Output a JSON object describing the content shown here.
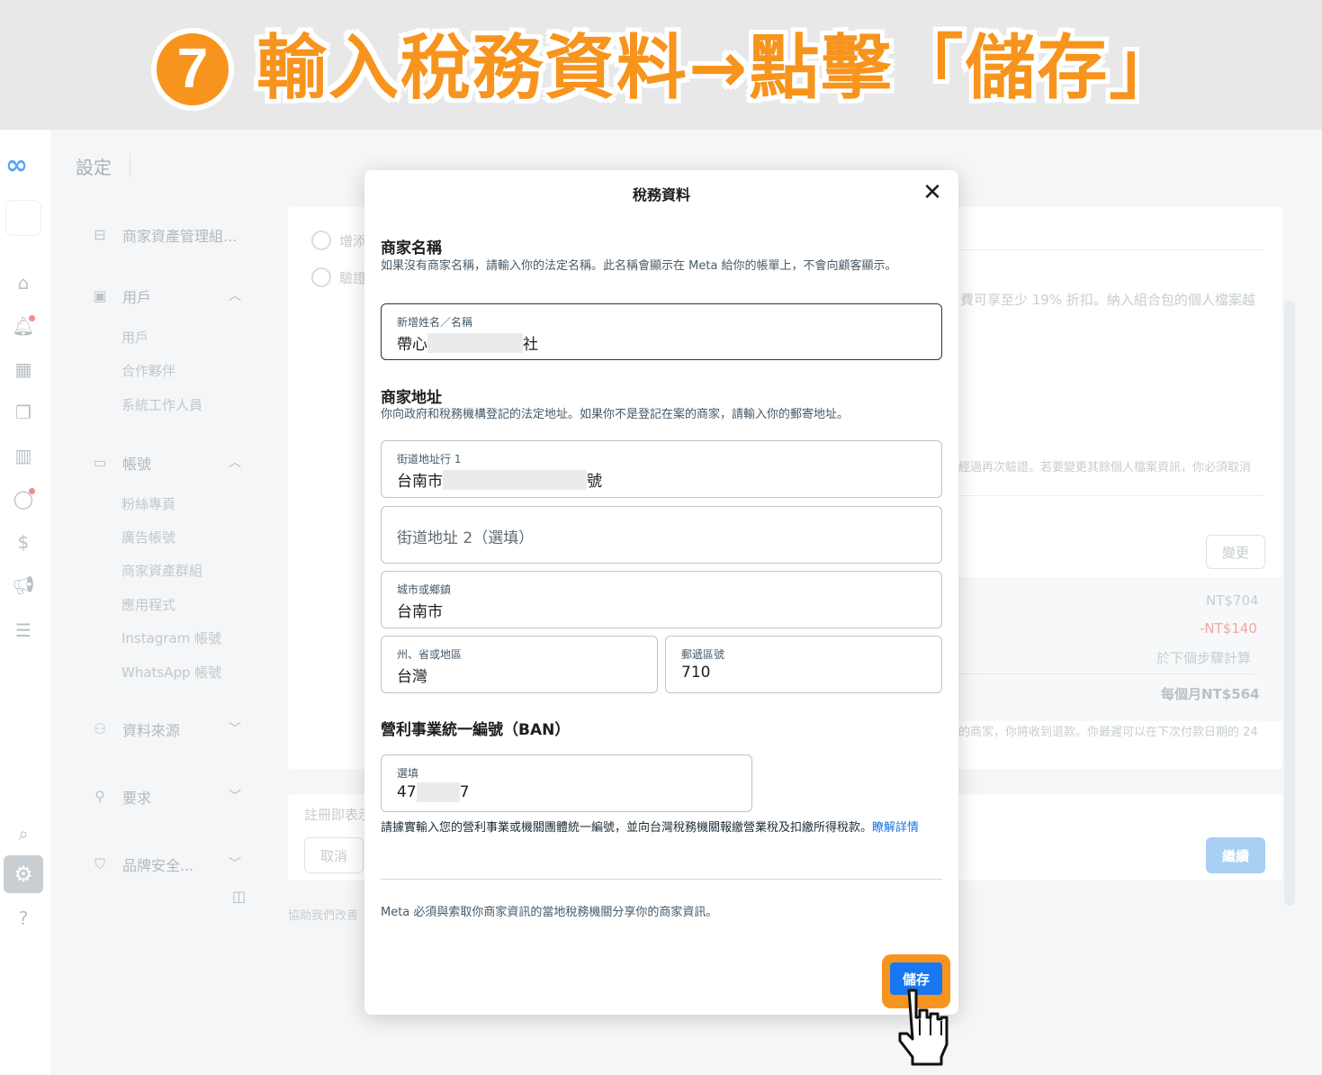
{
  "banner": {
    "step_number": "7",
    "title": "輸入稅務資料→點擊「儲存」"
  },
  "sidebar": {
    "title": "設定",
    "sections": [
      {
        "label": "商家資產管理組...",
        "icon": "briefcase-icon"
      },
      {
        "label": "用戶",
        "icon": "person-card-icon",
        "items": [
          "用戶",
          "合作夥伴",
          "系統工作人員"
        ]
      },
      {
        "label": "帳號",
        "icon": "folder-icon",
        "items": [
          "粉絲專頁",
          "廣告帳號",
          "商家資產群組",
          "應用程式",
          "Instagram 帳號",
          "WhatsApp 帳號"
        ]
      },
      {
        "label": "資料來源",
        "icon": "people-icon"
      },
      {
        "label": "要求",
        "icon": "person-add-icon"
      },
      {
        "label": "品牌安全...",
        "icon": "shield-icon"
      }
    ]
  },
  "background": {
    "steps": [
      "增添",
      "驗證"
    ],
    "discount_text": "費可享至少 19% 折扣。納入組合包的個人檔案越",
    "verify_text": "經過再次驗證。若要變更其餘個人檔案資訊，你必須取消",
    "change_button": "變更",
    "price_1": "NT$704",
    "price_2": "-NT$140",
    "price_note": "於下個步驟計算",
    "monthly": "每個月NT$564",
    "refund_text": "的商家，你將收到退款。你最遲可以在下次付款日期的 24",
    "register_text": "註冊即表示",
    "cancel_button": "取消",
    "continue_button": "繼續",
    "help_text": "協助我們改善"
  },
  "modal": {
    "title": "稅務資料",
    "business_name": {
      "heading": "商家名稱",
      "description": "如果沒有商家名稱，請輸入你的法定名稱。此名稱會顯示在 Meta 給你的帳單上，不會向顧客顯示。",
      "field_label": "新增姓名／名稱",
      "value_prefix": "帶心",
      "value_suffix": "社"
    },
    "address": {
      "heading": "商家地址",
      "description": "你向政府和稅務機構登記的法定地址。如果你不是登記在案的商家，請輸入你的郵寄地址。",
      "street1_label": "街道地址行 1",
      "street1_prefix": "台南市",
      "street1_suffix": "號",
      "street2_placeholder": "街道地址 2（選填）",
      "city_label": "城市或鄉鎮",
      "city_value": "台南市",
      "state_label": "州、省或地區",
      "state_value": "台灣",
      "zip_label": "郵遞區號",
      "zip_value": "710"
    },
    "ban": {
      "heading": "營利事業統一編號（BAN）",
      "field_label": "選填",
      "value_prefix": "47",
      "value_suffix": "7",
      "note": "請據實輸入您的營利事業或機關團體統一編號，並向台灣稅務機關報繳營業稅及扣繳所得稅款。",
      "link": "瞭解詳情"
    },
    "footer_note": "Meta 必須與索取你商家資訊的當地稅務機關分享你的商家資訊。",
    "save_button": "儲存"
  },
  "colors": {
    "accent_orange": "#f7941d",
    "primary_blue": "#1877f2",
    "link_blue": "#1a73e3"
  }
}
